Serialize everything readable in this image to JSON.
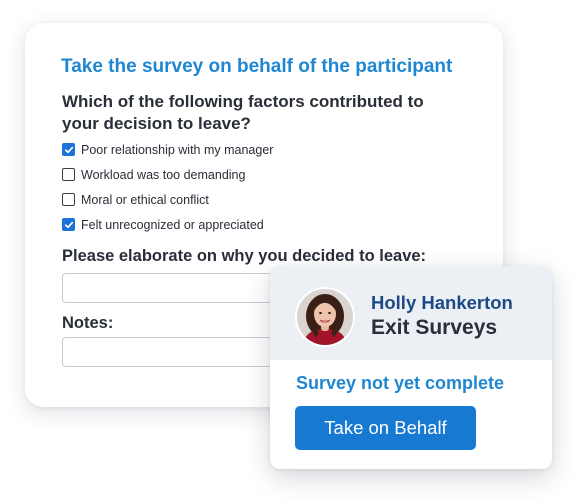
{
  "survey": {
    "heading": "Take the survey on behalf of the participant",
    "question": "Which of the following factors contributed to your decision to leave?",
    "options": [
      {
        "label": "Poor relationship with my manager",
        "checked": true
      },
      {
        "label": "Workload was too demanding",
        "checked": false
      },
      {
        "label": "Moral or ethical conflict",
        "checked": false
      },
      {
        "label": "Felt unrecognized or appreciated",
        "checked": true
      }
    ],
    "elaborate_label": "Please elaborate on why you decided to leave:",
    "elaborate_value": "",
    "notes_label": "Notes:",
    "notes_value": ""
  },
  "participant": {
    "name": "Holly Hankerton",
    "module": "Exit Surveys",
    "status": "Survey not yet complete",
    "button_label": "Take on Behalf"
  },
  "icons": {
    "checkbox_checked": "check-icon",
    "avatar": "participant-photo"
  },
  "colors": {
    "accent_blue": "#1f87d1",
    "button_blue": "#1879d2",
    "checkbox_blue": "#1a73d8",
    "name_navy": "#1c4a86",
    "header_gray": "#eceff3"
  }
}
